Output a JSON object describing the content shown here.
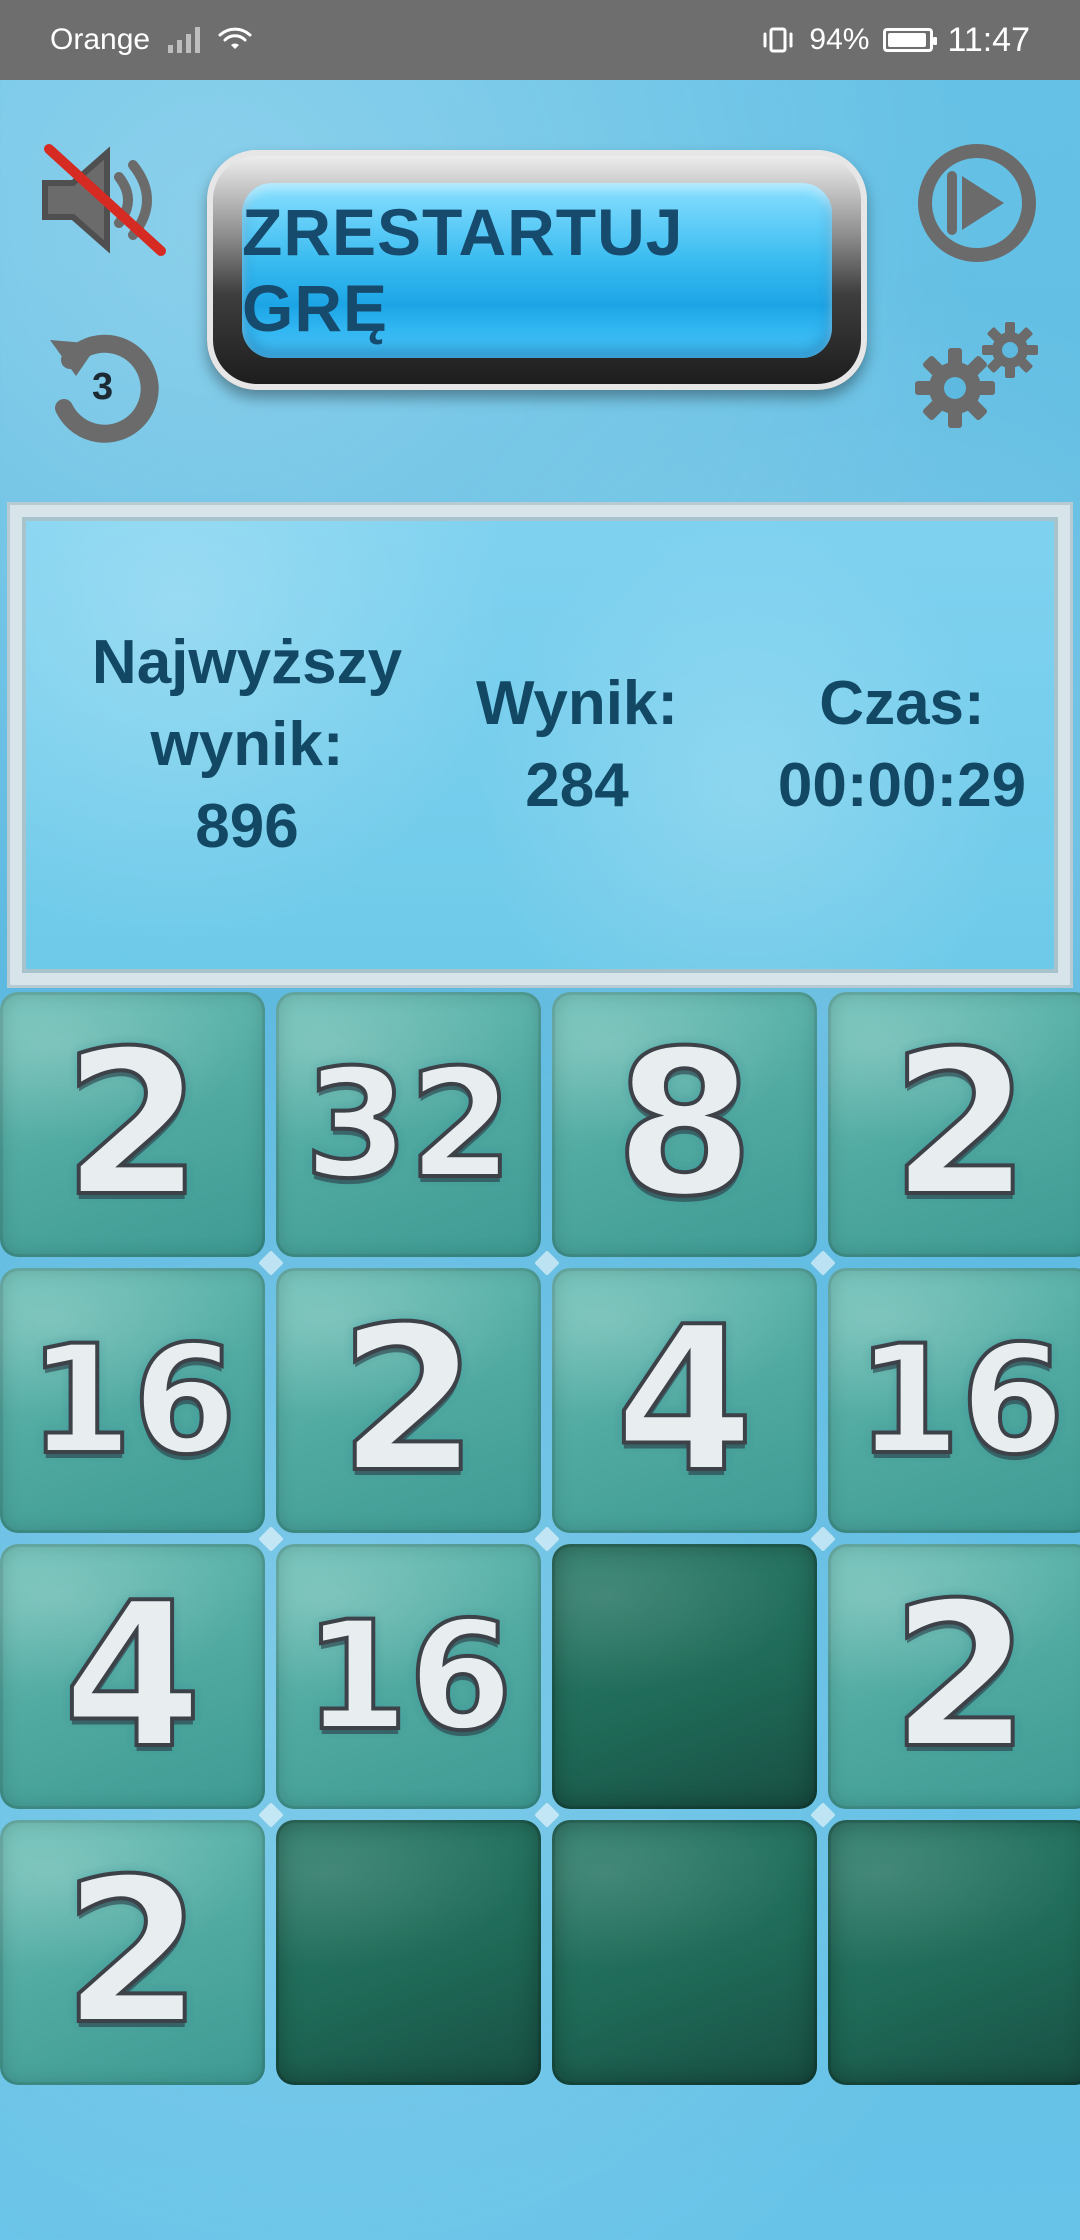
{
  "status_bar": {
    "carrier": "Orange",
    "battery_percent": "94%",
    "battery_fraction": 0.94,
    "time": "11:47"
  },
  "top_controls": {
    "restart_label": "ZRESTARTUJ GRĘ",
    "undo_count": "3"
  },
  "score_panel": {
    "best": {
      "label_line1": "Najwyższy",
      "label_line2": "wynik:",
      "value": "896"
    },
    "score": {
      "label": "Wynik:",
      "value": "284"
    },
    "time": {
      "label": "Czas:",
      "value": "00:00:29"
    }
  },
  "board": {
    "rows": [
      [
        "2",
        "32",
        "8",
        "2"
      ],
      [
        "16",
        "2",
        "4",
        "16"
      ],
      [
        "4",
        "16",
        "",
        "2"
      ],
      [
        "2",
        "",
        "",
        ""
      ]
    ]
  }
}
